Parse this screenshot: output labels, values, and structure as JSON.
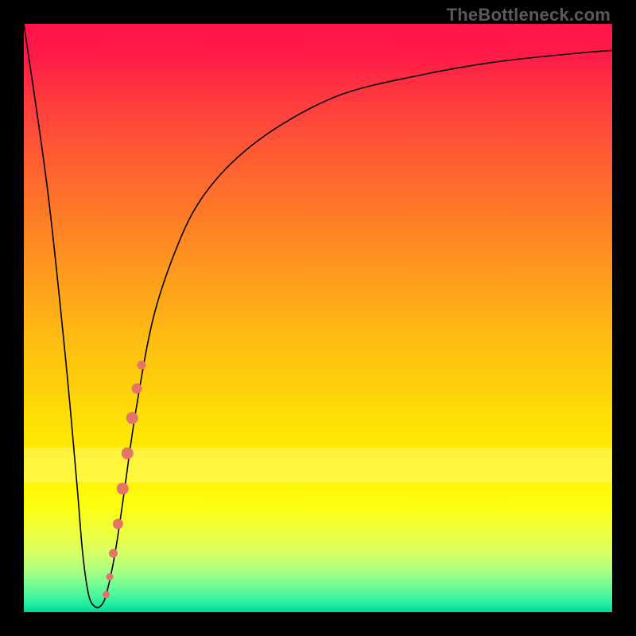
{
  "watermark": "TheBottleneck.com",
  "colors": {
    "dot": "#e57368",
    "curve": "#000000",
    "frame": "#000000"
  },
  "chart_data": {
    "type": "line",
    "title": "",
    "xlabel": "",
    "ylabel": "",
    "xlim": [
      0,
      100
    ],
    "ylim": [
      0,
      100
    ],
    "grid": false,
    "curve": {
      "x": [
        0,
        4,
        7,
        9,
        10,
        11,
        12,
        13,
        14,
        15.5,
        17,
        19,
        22,
        26,
        30,
        36,
        44,
        54,
        66,
        80,
        94,
        100
      ],
      "y": [
        100,
        72,
        44,
        22,
        10,
        3,
        1,
        1,
        3,
        10,
        20,
        34,
        50,
        62,
        70,
        77,
        83,
        88,
        91,
        93.5,
        95,
        95.5
      ]
    },
    "highlight_band_y": [
      22,
      28
    ],
    "dots": [
      {
        "x": 14.0,
        "y": 3.0,
        "r": 4
      },
      {
        "x": 14.6,
        "y": 6.0,
        "r": 4
      },
      {
        "x": 15.2,
        "y": 10.0,
        "r": 5
      },
      {
        "x": 16.0,
        "y": 15.0,
        "r": 6
      },
      {
        "x": 16.8,
        "y": 21.0,
        "r": 7
      },
      {
        "x": 17.6,
        "y": 27.0,
        "r": 7
      },
      {
        "x": 18.4,
        "y": 33.0,
        "r": 7
      },
      {
        "x": 19.2,
        "y": 38.0,
        "r": 6
      },
      {
        "x": 20.0,
        "y": 42.0,
        "r": 5
      }
    ]
  }
}
